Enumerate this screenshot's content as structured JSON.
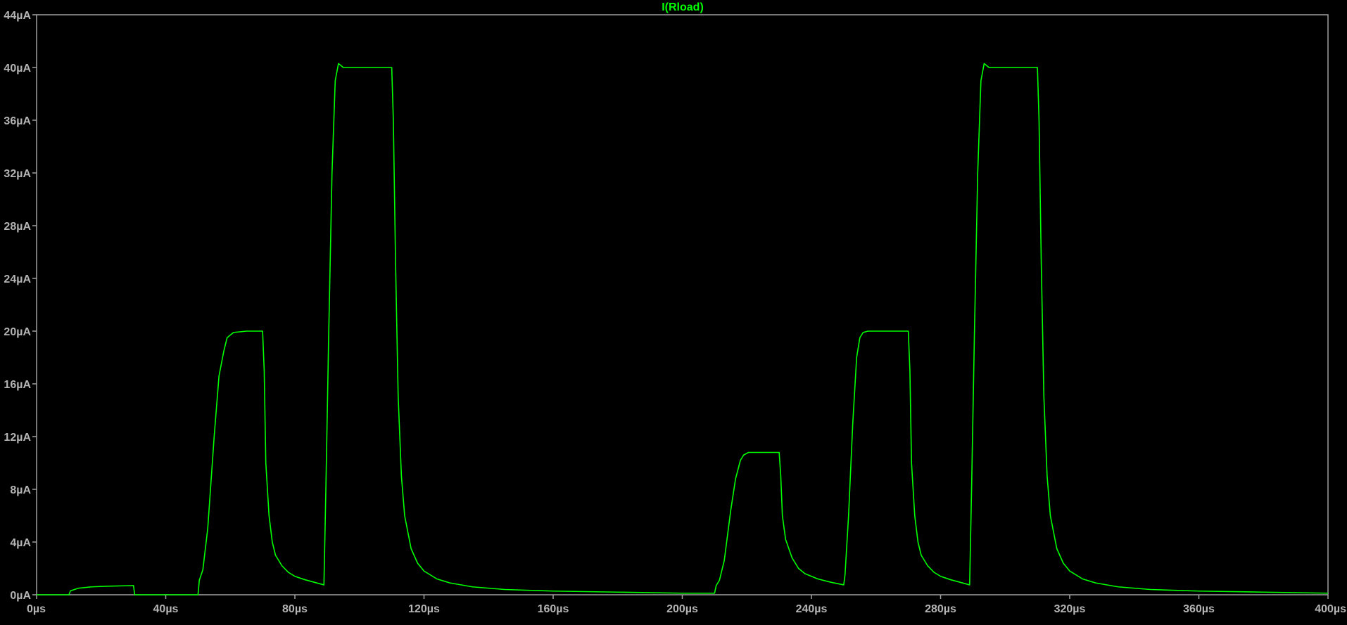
{
  "colors": {
    "background": "#000000",
    "frame": "#a0a0a0",
    "tick_label": "#b4b4b4",
    "trace": "#00ff00"
  },
  "chart_data": {
    "type": "line",
    "title": "I(Rload)",
    "xlabel": "",
    "ylabel": "",
    "xlim": [
      0,
      400
    ],
    "ylim": [
      0,
      44
    ],
    "x_unit": "µs",
    "y_unit": "µA",
    "grid": false,
    "x_ticks": [
      "0µs",
      "40µs",
      "80µs",
      "120µs",
      "160µs",
      "200µs",
      "240µs",
      "280µs",
      "320µs",
      "360µs",
      "400µs"
    ],
    "y_ticks": [
      "0µA",
      "4µA",
      "8µA",
      "12µA",
      "16µA",
      "20µA",
      "24µA",
      "28µA",
      "32µA",
      "36µA",
      "40µA",
      "44µA"
    ],
    "series": [
      {
        "name": "I(Rload)",
        "color": "#00ff00",
        "x": [
          0,
          10,
          10.5,
          13,
          17,
          22,
          27,
          30,
          30.4,
          31,
          40,
          50,
          50.4,
          51.5,
          53,
          55,
          56.5,
          58,
          59,
          61,
          65,
          70,
          70.5,
          71,
          72,
          73,
          74,
          76,
          78,
          80,
          83,
          86,
          89,
          89.6,
          90.5,
          91.5,
          92.5,
          93.5,
          95,
          100,
          105,
          110,
          110.5,
          111.2,
          112,
          113,
          114,
          116,
          118,
          120,
          124,
          128,
          135,
          145,
          160,
          180,
          200,
          210,
          210.5,
          211.5,
          213,
          215,
          216.5,
          218,
          219,
          220.5,
          223,
          227,
          230,
          230.5,
          231,
          232,
          234,
          236,
          238,
          242,
          246,
          250,
          250.4,
          251.5,
          252.8,
          254,
          255,
          256,
          257.5,
          259,
          262,
          266,
          270,
          270.5,
          271,
          272,
          273,
          274,
          276,
          278,
          280,
          283,
          286,
          289,
          289.6,
          290.5,
          291.5,
          292.5,
          293.5,
          295,
          300,
          305,
          310,
          310.5,
          311.2,
          312,
          313,
          314,
          316,
          318,
          320,
          324,
          328,
          335,
          345,
          360,
          380,
          400
        ],
        "y": [
          0,
          0,
          0.3,
          0.5,
          0.6,
          0.65,
          0.68,
          0.7,
          0,
          0,
          0,
          0,
          1.1,
          1.9,
          5,
          12,
          16.6,
          18.5,
          19.5,
          19.9,
          20,
          20,
          17,
          10,
          6,
          4,
          3,
          2.2,
          1.7,
          1.4,
          1.15,
          0.95,
          0.75,
          8,
          20,
          32,
          39,
          40.3,
          40,
          40,
          40,
          40,
          36,
          25,
          15,
          9,
          6,
          3.5,
          2.4,
          1.8,
          1.2,
          0.9,
          0.6,
          0.4,
          0.28,
          0.2,
          0.12,
          0.12,
          0.7,
          1.1,
          2.6,
          6.4,
          8.8,
          10.2,
          10.6,
          10.8,
          10.8,
          10.8,
          10.8,
          9,
          6,
          4.2,
          2.8,
          2,
          1.6,
          1.2,
          0.95,
          0.75,
          1.5,
          6,
          13,
          18,
          19.5,
          19.9,
          20,
          20,
          20,
          20,
          20,
          17,
          10,
          6,
          4,
          3,
          2.2,
          1.7,
          1.4,
          1.15,
          0.95,
          0.75,
          8,
          20,
          32,
          39,
          40.3,
          40,
          40,
          40,
          40,
          36,
          25,
          15,
          9,
          6,
          3.5,
          2.4,
          1.8,
          1.2,
          0.9,
          0.6,
          0.4,
          0.28,
          0.2,
          0.12
        ]
      }
    ]
  }
}
